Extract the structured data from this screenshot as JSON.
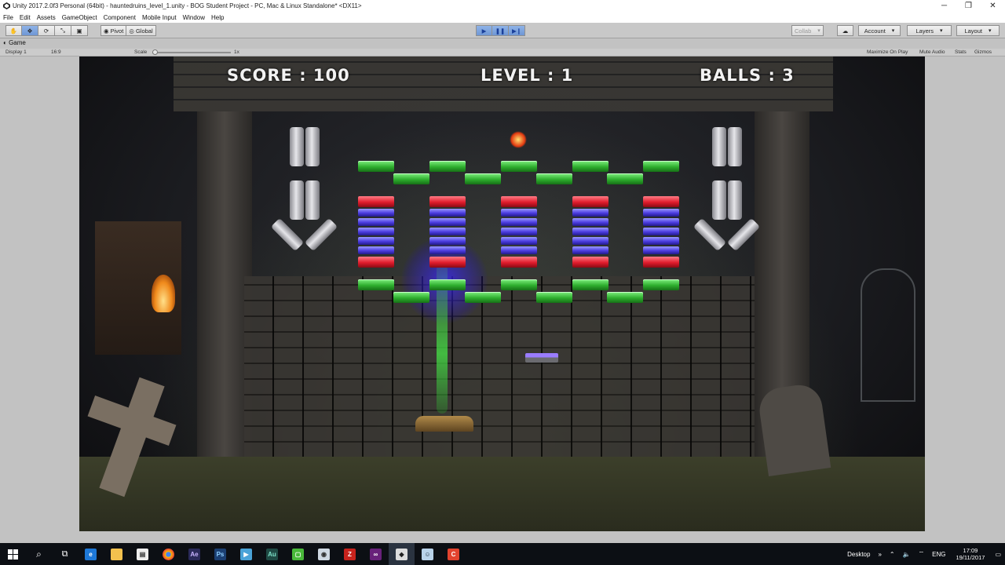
{
  "window": {
    "title": "Unity 2017.2.0f3 Personal (64bit) - hauntedruins_level_1.unity - BOG Student Project - PC, Mac & Linux Standalone* <DX11>",
    "minimize_icon": "minimize-icon",
    "maximize_icon": "restore-icon",
    "close_icon": "close-icon"
  },
  "menu": [
    "File",
    "Edit",
    "Assets",
    "GameObject",
    "Component",
    "Mobile Input",
    "Window",
    "Help"
  ],
  "toolbar": {
    "pivot": "Pivot",
    "global": "Global",
    "collab": "Collab",
    "account": "Account",
    "layers": "Layers",
    "layout": "Layout"
  },
  "game_panel": {
    "tab": "Game",
    "display": "Display 1",
    "aspect": "16:9",
    "scale_label": "Scale",
    "scale_value": "1x",
    "maximize_on_play": "Maximize On Play",
    "mute_audio": "Mute Audio",
    "stats": "Stats",
    "gizmos": "Gizmos"
  },
  "hud": {
    "score": "SCORE : 100",
    "level": "LEVEL : 1",
    "balls": "BALLS : 3"
  },
  "taskbar": {
    "desktop": "Desktop",
    "time": "17:09",
    "date": "19/11/2017"
  },
  "colors": {
    "green_brick": "#2eae2e",
    "red_brick": "#e01c2c",
    "blue_brick": "#4b3ce0",
    "play_active": "#6f97d4"
  }
}
